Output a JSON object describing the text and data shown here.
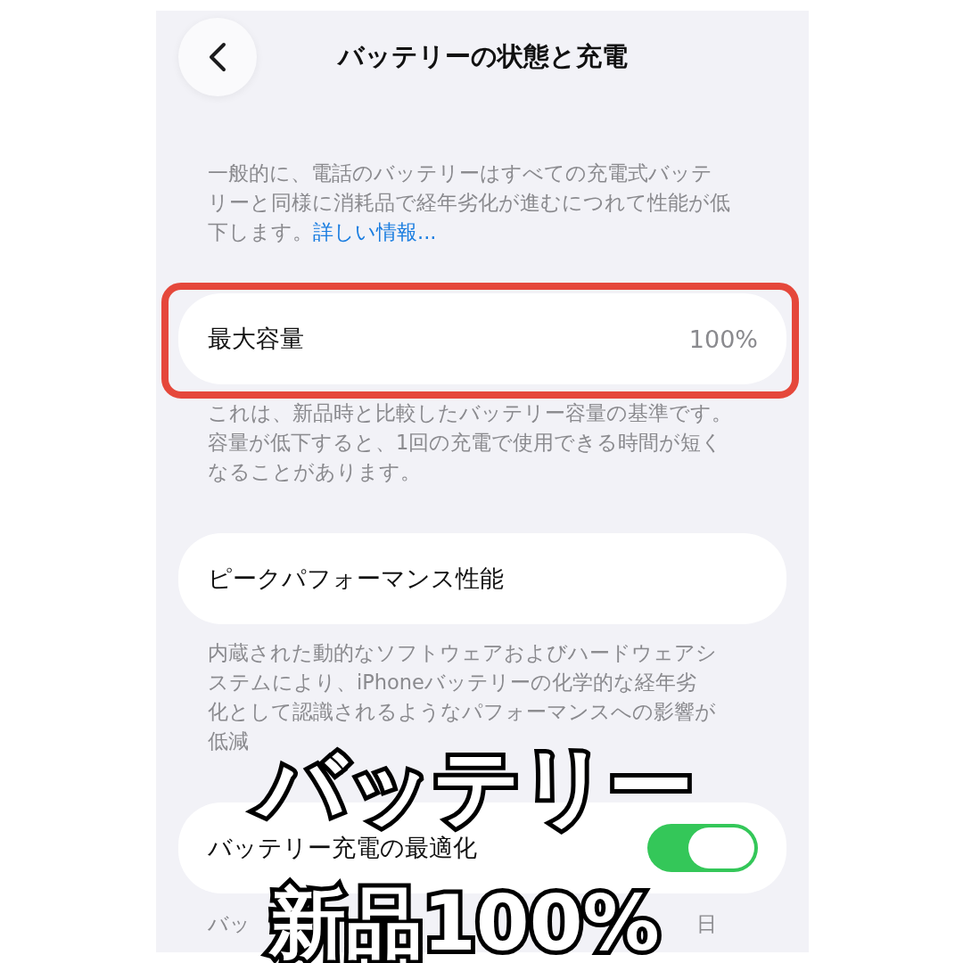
{
  "navigation_bar": {
    "title": "バッテリーの状態と充電"
  },
  "sections": [
    {
      "kind": "text",
      "lines": [
        "一般的に、電話のバッテリーはすべての充電式バッテ",
        "リーと同様に消耗品で経年劣化が進むにつれて性能が低",
        "下します。"
      ],
      "link": "詳しい情報..."
    },
    {
      "kind": "value",
      "label": "最大容量",
      "value": "100%",
      "highlighted": true
    },
    {
      "kind": "text",
      "lines": [
        "これは、新品時と比較したバッテリー容量の基準です。",
        "容量が低下すると、1回の充電で使用できる時間が短く",
        "なることがあります。"
      ]
    },
    {
      "kind": "plain",
      "label": "ピークパフォーマンス性能"
    },
    {
      "kind": "text",
      "lines": [
        "内蔵された動的なソフトウェアおよびハードウェアシ",
        "ステムにより、iPhoneバッテリーの化学的な経年劣",
        "化として認識されるようなパフォーマンスへの影響が",
        "低減"
      ]
    },
    {
      "kind": "toggle",
      "label": "バッテリー充電の最適化",
      "on": true
    },
    {
      "kind": "fragments",
      "fragments": [
        "バッ",
        "日"
      ]
    }
  ],
  "caption": [
    "バッテリー",
    "新品100%"
  ]
}
